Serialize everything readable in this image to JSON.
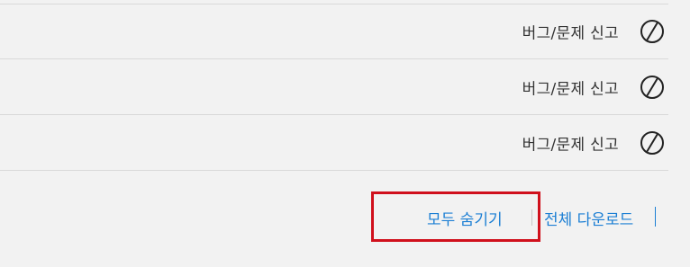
{
  "rows": [
    {
      "report_label": "버그/문제 신고",
      "icon": "block-icon"
    },
    {
      "report_label": "버그/문제 신고",
      "icon": "block-icon"
    },
    {
      "report_label": "버그/문제 신고",
      "icon": "block-icon"
    }
  ],
  "footer": {
    "hide_all_label": "모두 숨기기",
    "download_all_label": "전체 다운로드"
  },
  "colors": {
    "link": "#1c7fd4",
    "highlight": "#d0101c",
    "background": "#f2f2f2"
  }
}
